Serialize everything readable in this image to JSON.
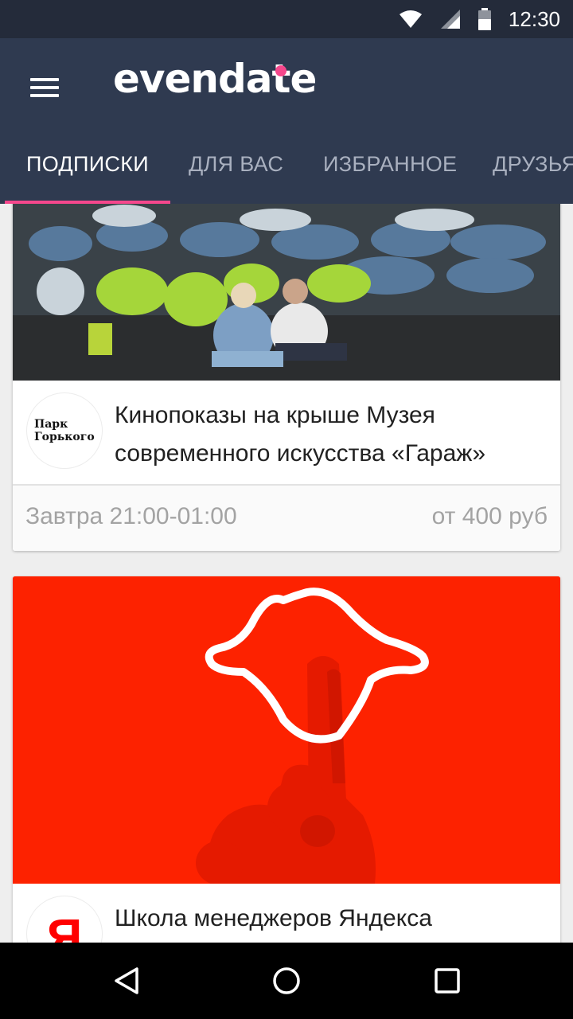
{
  "status_bar": {
    "time": "12:30",
    "icons": [
      "wifi-icon",
      "signal-icon",
      "battery-icon"
    ]
  },
  "app_bar": {
    "logo_text": "evendate",
    "menu_icon": "hamburger-menu-icon",
    "colors": {
      "bar": "#2f3a50",
      "status": "#242b3a",
      "accent": "#f5478c"
    }
  },
  "tabs": [
    {
      "label": "ПОДПИСКИ",
      "active": true
    },
    {
      "label": "ДЛЯ ВАС",
      "active": false
    },
    {
      "label": "ИЗБРАННОЕ",
      "active": false
    },
    {
      "label": "ДРУЗЬЯ",
      "active": false
    }
  ],
  "events": [
    {
      "org_name": "Парк Горького",
      "org_logo_lines": [
        "Парк",
        "Горького"
      ],
      "title": "Кинопоказы на крыше Музея современного искусства «Гараж»",
      "date": "Завтра 21:00-01:00",
      "price": "от 400 руб",
      "image": "rooftop-cinema-audience-photo"
    },
    {
      "org_name": "Яндекс",
      "org_logo_letter": "Я",
      "title": "Школа менеджеров Яндекса",
      "image": "red-hand-finger-poster",
      "image_color": "#fd2200"
    }
  ],
  "nav_bar": {
    "buttons": [
      "back-icon",
      "home-icon",
      "recents-icon"
    ]
  }
}
